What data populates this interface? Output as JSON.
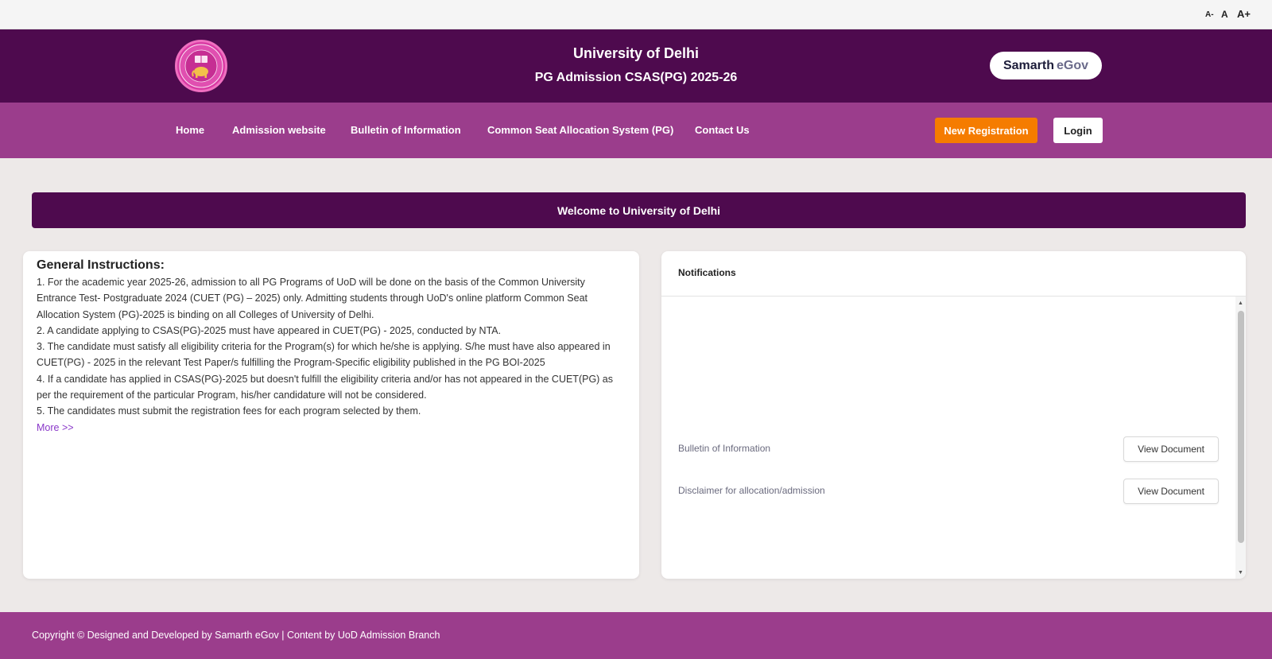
{
  "font_controls": {
    "small": "A-",
    "normal": "A",
    "large": "A+"
  },
  "header": {
    "logo_icon": "university-of-delhi-seal",
    "title": "University of Delhi",
    "subtitle": "PG Admission CSAS(PG) 2025-26",
    "brand_part1": "Samarth",
    "brand_part2": "eGov"
  },
  "nav": {
    "items": [
      {
        "label": "Home"
      },
      {
        "label": "Admission website"
      },
      {
        "label": "Bulletin of Information"
      },
      {
        "label": "Common Seat Allocation System (PG)"
      },
      {
        "label": "Contact Us"
      }
    ],
    "register_label": "New Registration",
    "login_label": "Login"
  },
  "welcome": "Welcome to University of Delhi",
  "instructions": {
    "heading": "General Instructions:",
    "items": [
      "1. For the academic year 2025-26, admission to all PG Programs of UoD will be done on the basis of the Common University Entrance Test- Postgraduate 2024 (CUET (PG) – 2025) only. Admitting students through UoD's online platform Common Seat Allocation System (PG)-2025 is binding on all Colleges of University of Delhi.",
      "2. A candidate applying to CSAS(PG)-2025 must have appeared in CUET(PG) - 2025, conducted by NTA.",
      "3. The candidate must satisfy all eligibility criteria for the Program(s) for which he/she is applying. S/he must have also appeared in CUET(PG) - 2025 in the relevant Test Paper/s fulfilling the Program-Specific eligibility published in the PG BOI-2025",
      "4. If a candidate has applied in CSAS(PG)-2025 but doesn't fulfill the eligibility criteria and/or has not appeared in the CUET(PG) as per the requirement of the particular Program, his/her candidature will not be considered.",
      "5. The candidates must submit the registration fees for each program selected by them."
    ],
    "more_label": "More >>"
  },
  "notifications": {
    "title": "Notifications",
    "items": [
      {
        "label": "Bulletin of Information",
        "button": "View Document"
      },
      {
        "label": "Disclaimer for allocation/admission",
        "button": "View Document"
      }
    ]
  },
  "footer": "Copyright © Designed and Developed by Samarth eGov | Content by UoD Admission Branch",
  "colors": {
    "header_bg": "#4e0a4e",
    "nav_bg": "#9b3d8c",
    "accent_orange": "#f57c00",
    "page_bg": "#ede9e8"
  }
}
